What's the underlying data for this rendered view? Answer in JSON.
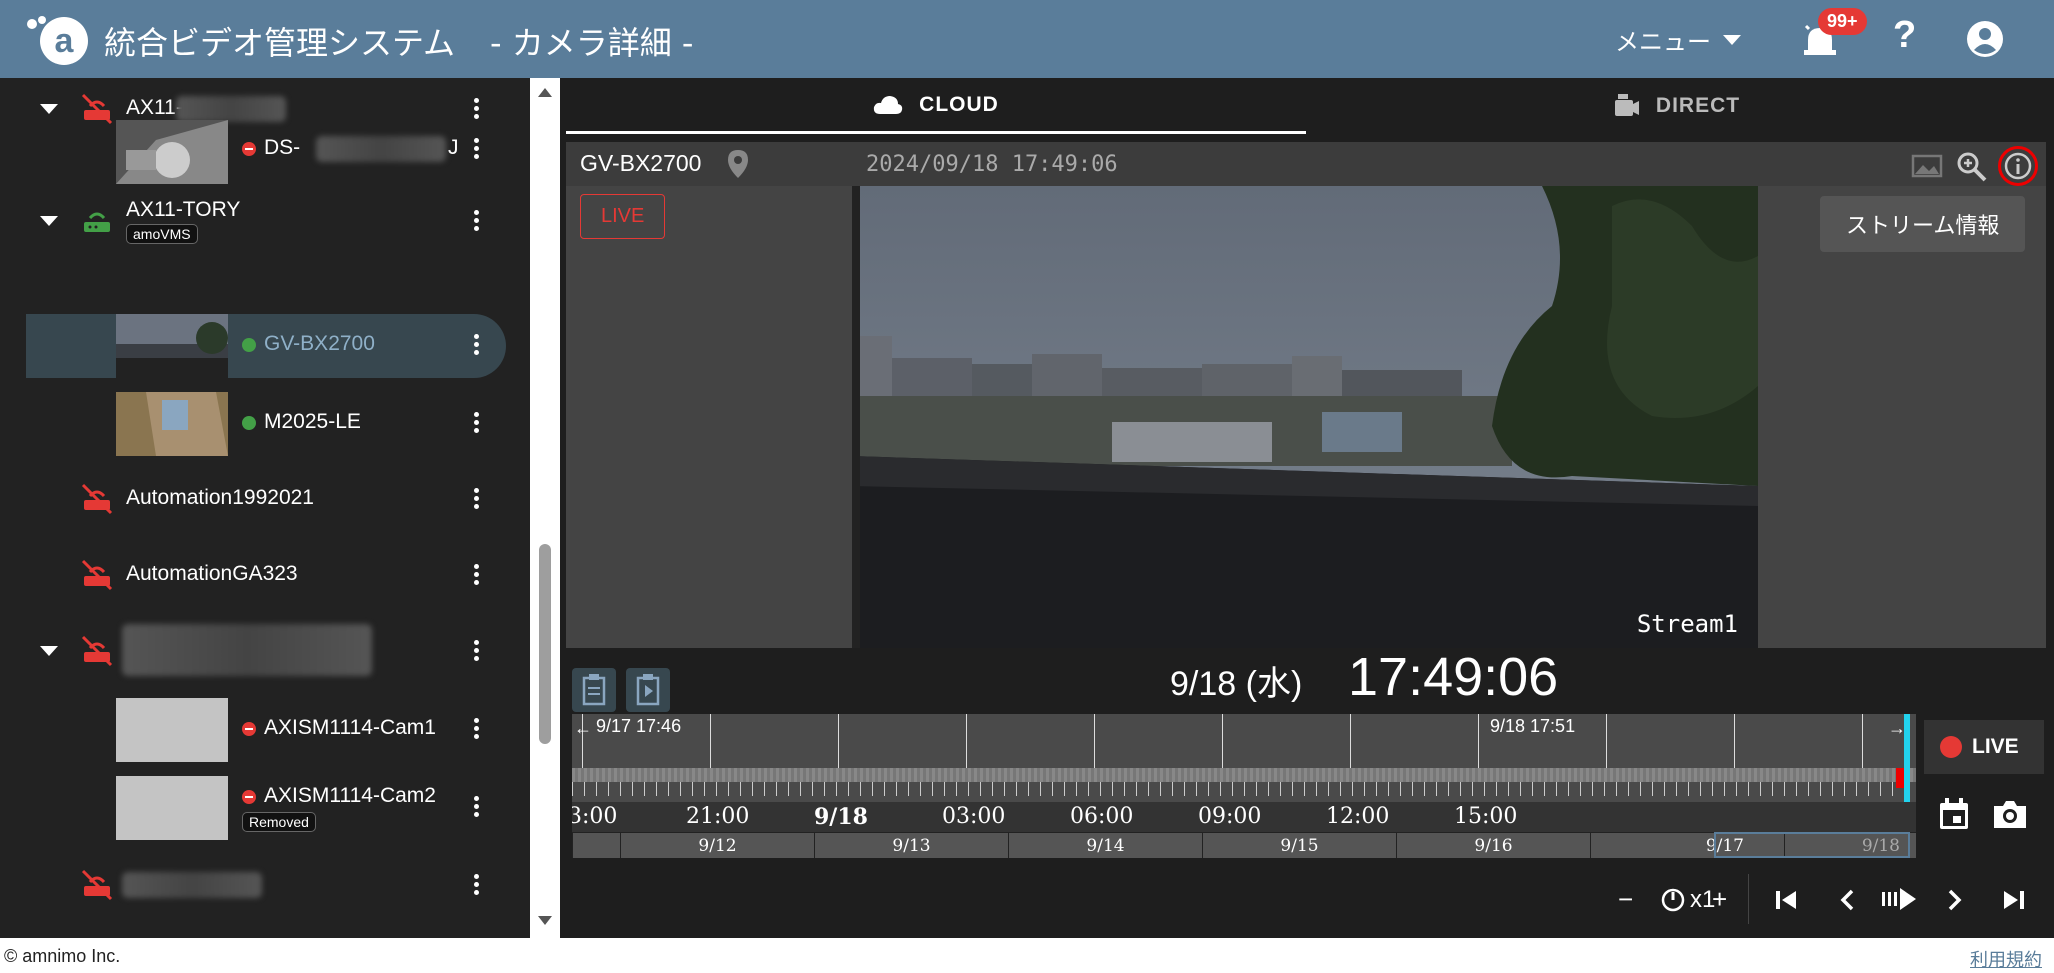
{
  "header": {
    "app_title": "統合ビデオ管理システム",
    "page_subtitle": "- カメラ詳細 -",
    "menu_label": "メニュー",
    "notification_badge": "99+",
    "help_label": "?"
  },
  "sidebar": {
    "gateways": [
      {
        "name": "AX11-",
        "status": "offline"
      },
      {
        "name": "AX11-TORY",
        "status": "online",
        "tag": "amoVMS"
      },
      {
        "name": "Automation1992021",
        "status": "offline"
      },
      {
        "name": "AutomationGA323",
        "status": "offline"
      }
    ],
    "cameras": [
      {
        "name": "DS-",
        "suffix": "J",
        "status": "offline"
      },
      {
        "name": "GV-BX2700",
        "status": "online",
        "selected": true
      },
      {
        "name": "M2025-LE",
        "status": "online"
      },
      {
        "name": "AXISM1114-Cam1",
        "status": "offline"
      },
      {
        "name": "AXISM1114-Cam2",
        "status": "offline",
        "tag": "Removed"
      }
    ]
  },
  "tabs": [
    {
      "label": "CLOUD",
      "active": true
    },
    {
      "label": "DIRECT",
      "active": false
    }
  ],
  "viewer": {
    "camera_name": "GV-BX2700",
    "timestamp_overlay": "2024/09/18  17:49:06",
    "live_chip": "LIVE",
    "stream_label": "Stream1",
    "stream_info_button": "ストリーム情報"
  },
  "playback": {
    "date": "9/18 (水)",
    "time": "17:49:06",
    "range_start": "9/17 17:46",
    "range_end": "9/18 17:51",
    "hours": [
      "3:00",
      "21:00",
      "9/18",
      "03:00",
      "06:00",
      "09:00",
      "12:00",
      "15:00"
    ],
    "days": [
      "9/12",
      "9/13",
      "9/14",
      "9/15",
      "9/16",
      "9/17",
      "9/18"
    ],
    "live_button": "LIVE",
    "speed_label": "x1",
    "minus": "−",
    "plus": "+"
  },
  "footer": {
    "copyright": "© amnimo Inc.",
    "terms": "利用規約"
  },
  "colors": {
    "header_bg": "#5a7d9a",
    "offline": "#e53935",
    "online": "#43a047",
    "timeline_cursor": "#22d3ee"
  }
}
